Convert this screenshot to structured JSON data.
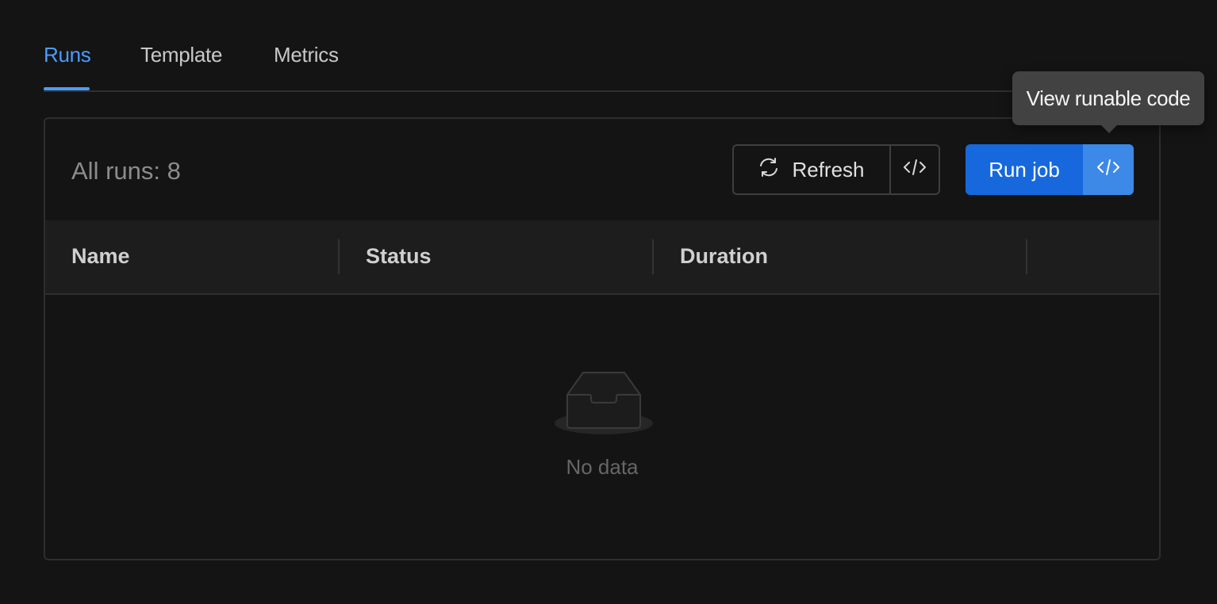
{
  "tabs": [
    {
      "label": "Runs",
      "active": true
    },
    {
      "label": "Template",
      "active": false
    },
    {
      "label": "Metrics",
      "active": false
    }
  ],
  "runs": {
    "count_label": "All runs: 8"
  },
  "toolbar": {
    "refresh_label": "Refresh",
    "refresh_icon": "sync-icon",
    "code_icon": "code-icon",
    "run_job_label": "Run job",
    "tooltip": "View runable code"
  },
  "table": {
    "columns": [
      "Name",
      "Status",
      "Duration"
    ],
    "empty_text": "No data",
    "empty_icon": "empty-inbox-icon"
  },
  "colors": {
    "accent": "#4a9dff",
    "primary": "#1668dc",
    "primary_secondary": "#3c89e8",
    "background": "#141414"
  }
}
